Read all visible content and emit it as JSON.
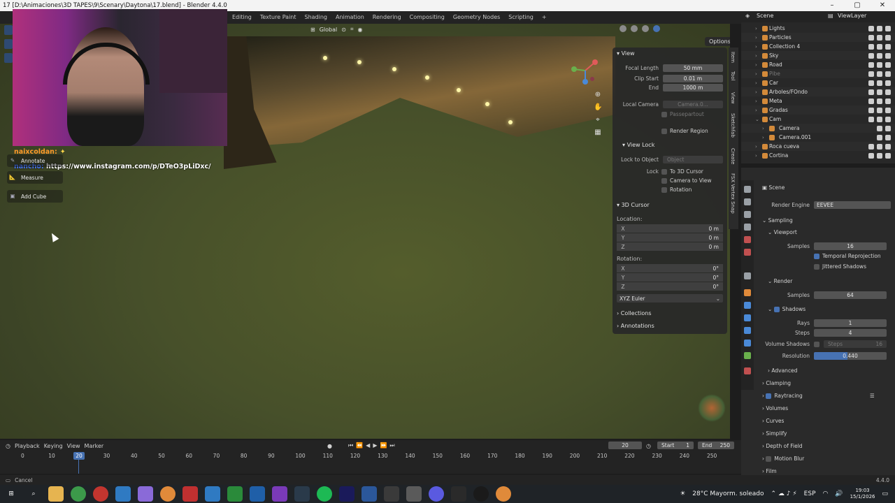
{
  "window": {
    "title": "17 [D:\\Animaciones\\3D TAPES\\9\\Scenary\\Daytona\\17.blend] - Blender 4.4.0",
    "controls": [
      "–",
      "▢",
      "✕"
    ]
  },
  "workspaces": [
    "Editing",
    "Texture Paint",
    "Shading",
    "Animation",
    "Rendering",
    "Compositing",
    "Geometry Nodes",
    "Scripting"
  ],
  "viewport": {
    "orientation": "Global",
    "options_label": "Options"
  },
  "chat": {
    "user1": "naixcoldan:",
    "user2": "nancho:",
    "message2": "https://www.instagram.com/p/DTeO3pLiDxc/"
  },
  "tools": {
    "annotate": "Annotate",
    "measure": "Measure",
    "add_cube": "Add Cube"
  },
  "npanel": {
    "view_header": "View",
    "focal_length_label": "Focal Length",
    "focal_length_value": "50 mm",
    "clip_start_label": "Clip Start",
    "clip_start_value": "0.01 m",
    "end_label": "End",
    "end_value": "1000 m",
    "local_camera_label": "Local Camera",
    "local_camera_value": "Camera.0...",
    "passepartout": "Passepartout",
    "render_region": "Render Region",
    "view_lock_header": "View Lock",
    "lock_to_object_label": "Lock to Object",
    "lock_to_object_value": "Object",
    "lock_label": "Lock",
    "to_3d_cursor": "To 3D Cursor",
    "camera_to_view": "Camera to View",
    "rotation_check": "Rotation",
    "cursor_header": "3D Cursor",
    "location_label": "Location:",
    "loc_x": "0 m",
    "loc_y": "0 m",
    "loc_z": "0 m",
    "rotation_label": "Rotation:",
    "rot_x": "0°",
    "rot_y": "0°",
    "rot_z": "0°",
    "rotation_mode": "XYZ Euler",
    "collections": "Collections",
    "annotations": "Annotations",
    "axis_x": "X",
    "axis_y": "Y",
    "axis_z": "Z"
  },
  "side_tabs": [
    "Item",
    "Tool",
    "View",
    "Sketchfab",
    "Create",
    "FSX Vertex Snap"
  ],
  "outliner": {
    "scene": "Scene",
    "view_layer": "ViewLayer",
    "items": [
      "Lights",
      "Particles",
      "Collection 4",
      "Sky",
      "Road",
      "Pibe",
      "Car",
      "Arboles/FOndo",
      "Meta",
      "Gradas",
      "Cam",
      "Camera",
      "Camera.001",
      "Roca cueva",
      "Cortina"
    ]
  },
  "properties": {
    "scene": "Scene",
    "render_engine_label": "Render Engine",
    "render_engine_value": "EEVEE",
    "sampling": "Sampling",
    "viewport": "Viewport",
    "samples_label": "Samples",
    "viewport_samples": "16",
    "temporal_reprojection": "Temporal Reprojection",
    "jittered_shadows": "Jittered Shadows",
    "render": "Render",
    "render_samples": "64",
    "shadows": "Shadows",
    "rays_label": "Rays",
    "rays_value": "1",
    "steps_label": "Steps",
    "steps_value": "4",
    "volume_shadows": "Volume Shadows",
    "vol_steps_label": "Steps",
    "vol_steps_value": "16",
    "resolution_label": "Resolution",
    "resolution_value": "0.440",
    "advanced": "Advanced",
    "clamping": "Clamping",
    "raytracing": "Raytracing",
    "volumes": "Volumes",
    "curves": "Curves",
    "simplify": "Simplify",
    "depth_of_field": "Depth of Field",
    "motion_blur": "Motion Blur",
    "film": "Film"
  },
  "timeline": {
    "menus": [
      "Playback",
      "Keying",
      "View",
      "Marker"
    ],
    "current_frame": "20",
    "current_frame_display": "20",
    "start_label": "Start",
    "start_value": "1",
    "end_label": "End",
    "end_value": "250",
    "frames": [
      "0",
      "10",
      "30",
      "40",
      "50",
      "60",
      "70",
      "80",
      "90",
      "100",
      "110",
      "120",
      "130",
      "140",
      "150",
      "160",
      "170",
      "180",
      "190",
      "200",
      "210",
      "220",
      "230",
      "240",
      "250"
    ]
  },
  "status": {
    "left": "Cancel",
    "version": "4.4.0"
  },
  "taskbar": {
    "weather": "28°C  Mayorm. soleado",
    "lang": "ESP",
    "time": "19:03",
    "date": "15/1/2026"
  }
}
